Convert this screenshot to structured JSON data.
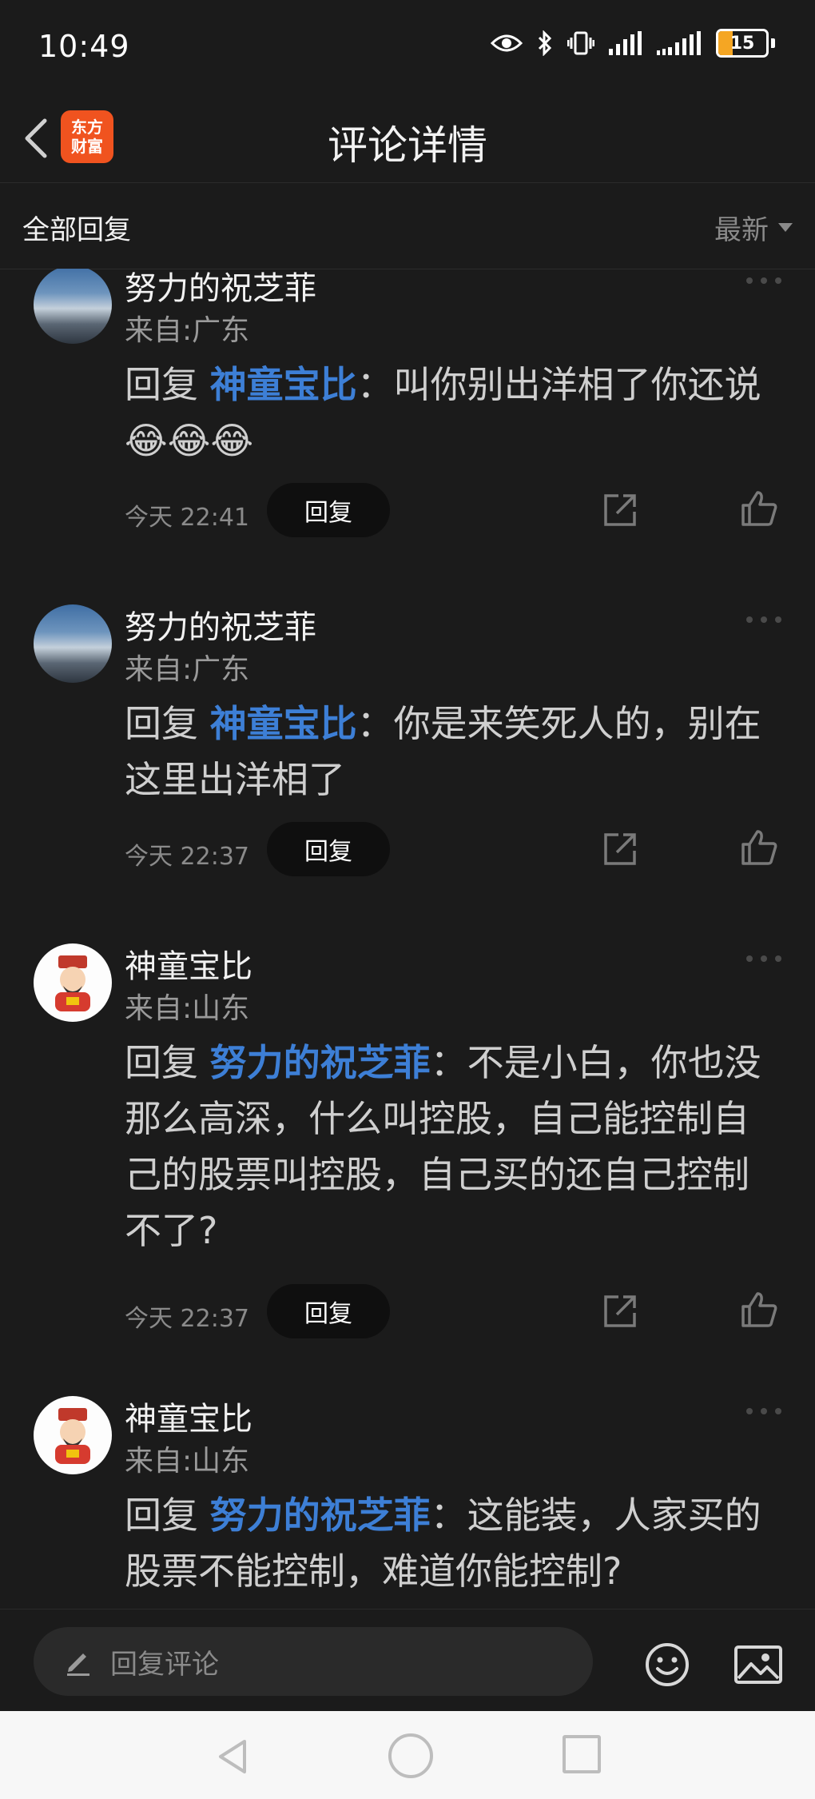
{
  "status": {
    "time": "10:49",
    "battery": "15"
  },
  "header": {
    "title": "评论详情",
    "logo_line1": "东方",
    "logo_line2": "财富"
  },
  "sort": {
    "label": "全部回复",
    "selected": "最新"
  },
  "comments": [
    {
      "user": "努力的祝芝菲",
      "location": "来自:广东",
      "reply_prefix": "回复 ",
      "mention": "神童宝比",
      "text": "：叫你别出洋相了你还说😂😂😂",
      "time": "今天 22:41",
      "reply_label": "回复"
    },
    {
      "user": "努力的祝芝菲",
      "location": "来自:广东",
      "reply_prefix": "回复 ",
      "mention": "神童宝比",
      "text": "：你是来笑死人的，别在这里出洋相了",
      "time": "今天 22:37",
      "reply_label": "回复"
    },
    {
      "user": "神童宝比",
      "location": "来自:山东",
      "reply_prefix": "回复 ",
      "mention": "努力的祝芝菲",
      "text": "：不是小白，你也没那么高深，什么叫控股，自己能控制自己的股票叫控股，自己买的还自己控制不了?",
      "time": "今天 22:37",
      "reply_label": "回复"
    },
    {
      "user": "神童宝比",
      "location": "来自:山东",
      "reply_prefix": "回复 ",
      "mention": "努力的祝芝菲",
      "text": "：这能装，人家买的股票不能控制，难道你能控制?",
      "time": "",
      "reply_label": ""
    }
  ],
  "input": {
    "placeholder": "回复评论"
  }
}
